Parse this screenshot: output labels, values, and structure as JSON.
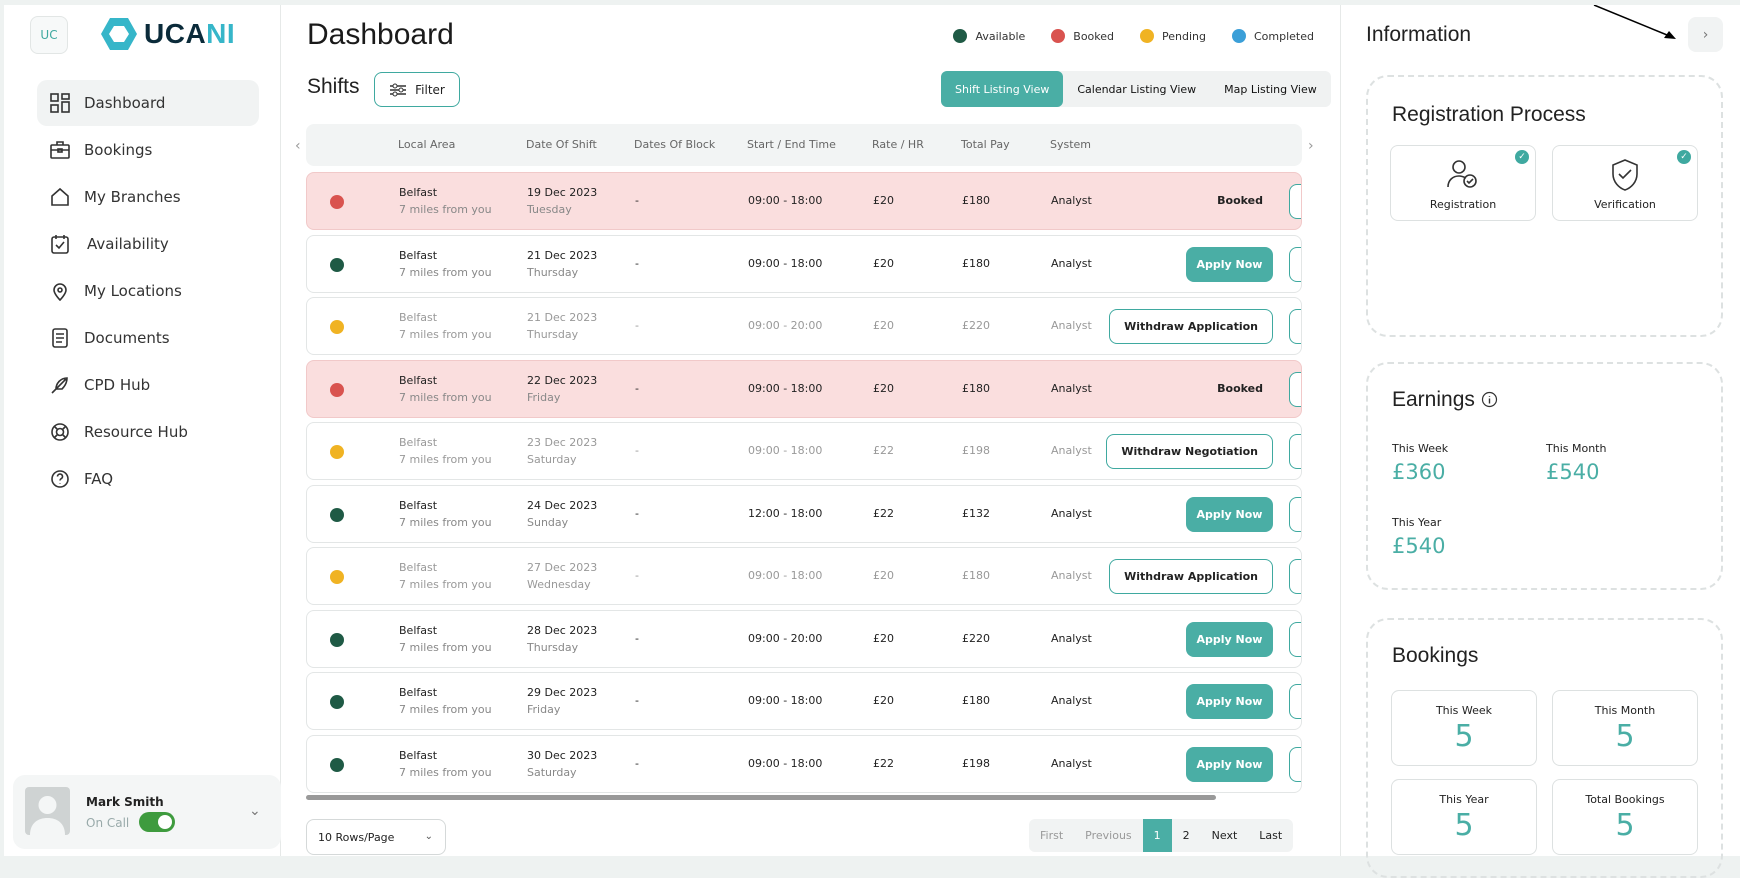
{
  "sidebar": {
    "badge": "UC",
    "logo": {
      "part1": "UCA",
      "part2": "NI"
    },
    "items": [
      {
        "label": "Dashboard",
        "icon": "grid-icon",
        "active": true
      },
      {
        "label": "Bookings",
        "icon": "briefcase-icon"
      },
      {
        "label": "My Branches",
        "icon": "home-icon"
      },
      {
        "label": "Availability",
        "icon": "calendar-check-icon"
      },
      {
        "label": "My Locations",
        "icon": "location-pin-icon"
      },
      {
        "label": "Documents",
        "icon": "document-icon"
      },
      {
        "label": "CPD Hub",
        "icon": "feather-icon"
      },
      {
        "label": "Resource Hub",
        "icon": "lifebuoy-icon"
      },
      {
        "label": "FAQ",
        "icon": "question-icon"
      }
    ],
    "user": {
      "name": "Mark Smith",
      "status": "On Call",
      "on_call": true
    }
  },
  "main": {
    "title": "Dashboard",
    "legend": [
      {
        "label": "Available",
        "color": "#1f5a45"
      },
      {
        "label": "Booked",
        "color": "#d9534f"
      },
      {
        "label": "Pending",
        "color": "#f0b323"
      },
      {
        "label": "Completed",
        "color": "#3b9fd8"
      }
    ],
    "shifts_label": "Shifts",
    "filter_label": "Filter",
    "views": [
      "Shift Listing View",
      "Calendar Listing View",
      "Map Listing View"
    ],
    "columns": [
      "Local Area",
      "Date Of Shift",
      "Dates Of Block",
      "Start / End Time",
      "Rate / HR",
      "Total Pay",
      "System"
    ],
    "rows": [
      {
        "status": "booked",
        "area": "Belfast",
        "distance": "7 miles from you",
        "date": "19 Dec 2023",
        "day": "Tuesday",
        "block": "-",
        "time": "09:00 - 18:00",
        "rate": "£20",
        "pay": "£180",
        "system": "Analyst",
        "action": "Booked"
      },
      {
        "status": "available",
        "area": "Belfast",
        "distance": "7 miles from you",
        "date": "21 Dec 2023",
        "day": "Thursday",
        "block": "-",
        "time": "09:00 - 18:00",
        "rate": "£20",
        "pay": "£180",
        "system": "Analyst",
        "action": "Apply Now"
      },
      {
        "status": "pending",
        "area": "Belfast",
        "distance": "7 miles from you",
        "date": "21 Dec 2023",
        "day": "Thursday",
        "block": "-",
        "time": "09:00 - 20:00",
        "rate": "£20",
        "pay": "£220",
        "system": "Analyst",
        "action": "Withdraw Application"
      },
      {
        "status": "booked",
        "area": "Belfast",
        "distance": "7 miles from you",
        "date": "22 Dec 2023",
        "day": "Friday",
        "block": "-",
        "time": "09:00 - 18:00",
        "rate": "£20",
        "pay": "£180",
        "system": "Analyst",
        "action": "Booked"
      },
      {
        "status": "pending",
        "area": "Belfast",
        "distance": "7 miles from you",
        "date": "23 Dec 2023",
        "day": "Saturday",
        "block": "-",
        "time": "09:00 - 18:00",
        "rate": "£22",
        "pay": "£198",
        "system": "Analyst",
        "action": "Withdraw Negotiation"
      },
      {
        "status": "available",
        "area": "Belfast",
        "distance": "7 miles from you",
        "date": "24 Dec 2023",
        "day": "Sunday",
        "block": "-",
        "time": "12:00 - 18:00",
        "rate": "£22",
        "pay": "£132",
        "system": "Analyst",
        "action": "Apply Now"
      },
      {
        "status": "pending",
        "area": "Belfast",
        "distance": "7 miles from you",
        "date": "27 Dec 2023",
        "day": "Wednesday",
        "block": "-",
        "time": "09:00 - 18:00",
        "rate": "£20",
        "pay": "£180",
        "system": "Analyst",
        "action": "Withdraw Application"
      },
      {
        "status": "available",
        "area": "Belfast",
        "distance": "7 miles from you",
        "date": "28 Dec 2023",
        "day": "Thursday",
        "block": "-",
        "time": "09:00 - 20:00",
        "rate": "£20",
        "pay": "£220",
        "system": "Analyst",
        "action": "Apply Now"
      },
      {
        "status": "available",
        "area": "Belfast",
        "distance": "7 miles from you",
        "date": "29 Dec 2023",
        "day": "Friday",
        "block": "-",
        "time": "09:00 - 18:00",
        "rate": "£20",
        "pay": "£180",
        "system": "Analyst",
        "action": "Apply Now"
      },
      {
        "status": "available",
        "area": "Belfast",
        "distance": "7 miles from you",
        "date": "30 Dec 2023",
        "day": "Saturday",
        "block": "-",
        "time": "09:00 - 18:00",
        "rate": "£22",
        "pay": "£198",
        "system": "Analyst",
        "action": "Apply Now"
      }
    ],
    "rows_per_page": "10 Rows/Page",
    "pager": [
      "First",
      "Previous",
      "1",
      "2",
      "Next",
      "Last"
    ],
    "current_page": "1"
  },
  "info": {
    "title": "Information",
    "registration": {
      "title": "Registration Process",
      "items": [
        "Registration",
        "Verification"
      ]
    },
    "earnings": {
      "title": "Earnings",
      "week_label": "This Week",
      "week": "£360",
      "month_label": "This Month",
      "month": "£540",
      "year_label": "This Year",
      "year": "£540"
    },
    "bookings": {
      "title": "Bookings",
      "items": [
        {
          "label": "This Week",
          "value": "5"
        },
        {
          "label": "This Month",
          "value": "5"
        },
        {
          "label": "This Year",
          "value": "5"
        },
        {
          "label": "Total Bookings",
          "value": "5"
        }
      ]
    }
  }
}
